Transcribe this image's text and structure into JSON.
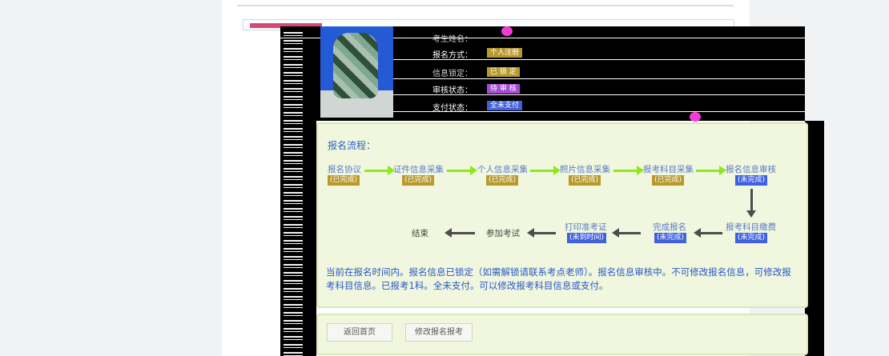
{
  "info": {
    "name_label": "考生姓名：",
    "method_label": "报名方式：",
    "method_value": "个人注册",
    "lock_label": "信息锁定：",
    "lock_value": "已 锁 定",
    "review_label": "审核状态：",
    "review_value": "待 审 核",
    "pay_label": "支付状态：",
    "pay_value": "全未支付"
  },
  "flow": {
    "title": "报名流程：",
    "steps_top": [
      {
        "label": "报名协议",
        "status": "(已完成)"
      },
      {
        "label": "证件信息采集",
        "status": "(已完成)"
      },
      {
        "label": "个人信息采集",
        "status": "(已完成)"
      },
      {
        "label": "照片信息采集",
        "status": "(已完成)"
      },
      {
        "label": "报考科目采集",
        "status": "(已完成)"
      },
      {
        "label": "报名信息审核",
        "status": "(未完成)"
      }
    ],
    "steps_bottom": [
      {
        "label": "报考科目缴费",
        "status": "(未完成)"
      },
      {
        "label": "完成报名",
        "status": "(未完成)"
      },
      {
        "label": "打印准考证",
        "status": "(未到时间)"
      },
      {
        "label": "参加考试"
      },
      {
        "label": "结束"
      }
    ],
    "notice": "当前在报名时间内。报名信息已锁定（如需解锁请联系考点老师）。报名信息审核中。不可修改报名信息，可修改报考科目信息。已报考1科。全未支付。可以修改报考科目信息或支付。"
  },
  "buttons": {
    "home": "返回首页",
    "modify": "修改报名报考"
  },
  "colors": {
    "panel_bg": "#f0f7de",
    "arrow_green": "#8ce81a",
    "badge_gold": "#b89a2c",
    "badge_blue": "#4060e0",
    "text_blue": "#2857c6"
  }
}
